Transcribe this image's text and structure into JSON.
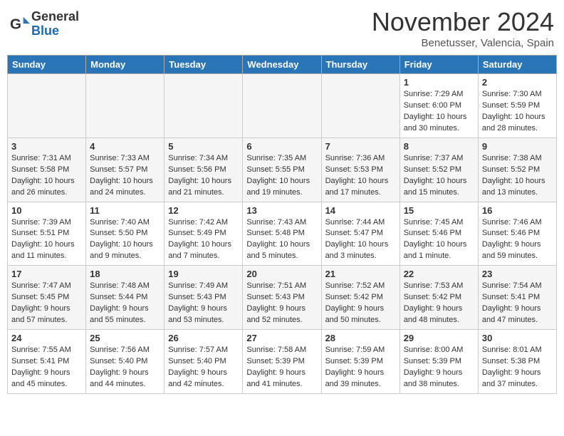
{
  "header": {
    "logo_general": "General",
    "logo_blue": "Blue",
    "month": "November 2024",
    "location": "Benetusser, Valencia, Spain"
  },
  "weekdays": [
    "Sunday",
    "Monday",
    "Tuesday",
    "Wednesday",
    "Thursday",
    "Friday",
    "Saturday"
  ],
  "weeks": [
    [
      {
        "day": "",
        "info": ""
      },
      {
        "day": "",
        "info": ""
      },
      {
        "day": "",
        "info": ""
      },
      {
        "day": "",
        "info": ""
      },
      {
        "day": "",
        "info": ""
      },
      {
        "day": "1",
        "info": "Sunrise: 7:29 AM\nSunset: 6:00 PM\nDaylight: 10 hours\nand 30 minutes."
      },
      {
        "day": "2",
        "info": "Sunrise: 7:30 AM\nSunset: 5:59 PM\nDaylight: 10 hours\nand 28 minutes."
      }
    ],
    [
      {
        "day": "3",
        "info": "Sunrise: 7:31 AM\nSunset: 5:58 PM\nDaylight: 10 hours\nand 26 minutes."
      },
      {
        "day": "4",
        "info": "Sunrise: 7:33 AM\nSunset: 5:57 PM\nDaylight: 10 hours\nand 24 minutes."
      },
      {
        "day": "5",
        "info": "Sunrise: 7:34 AM\nSunset: 5:56 PM\nDaylight: 10 hours\nand 21 minutes."
      },
      {
        "day": "6",
        "info": "Sunrise: 7:35 AM\nSunset: 5:55 PM\nDaylight: 10 hours\nand 19 minutes."
      },
      {
        "day": "7",
        "info": "Sunrise: 7:36 AM\nSunset: 5:53 PM\nDaylight: 10 hours\nand 17 minutes."
      },
      {
        "day": "8",
        "info": "Sunrise: 7:37 AM\nSunset: 5:52 PM\nDaylight: 10 hours\nand 15 minutes."
      },
      {
        "day": "9",
        "info": "Sunrise: 7:38 AM\nSunset: 5:52 PM\nDaylight: 10 hours\nand 13 minutes."
      }
    ],
    [
      {
        "day": "10",
        "info": "Sunrise: 7:39 AM\nSunset: 5:51 PM\nDaylight: 10 hours\nand 11 minutes."
      },
      {
        "day": "11",
        "info": "Sunrise: 7:40 AM\nSunset: 5:50 PM\nDaylight: 10 hours\nand 9 minutes."
      },
      {
        "day": "12",
        "info": "Sunrise: 7:42 AM\nSunset: 5:49 PM\nDaylight: 10 hours\nand 7 minutes."
      },
      {
        "day": "13",
        "info": "Sunrise: 7:43 AM\nSunset: 5:48 PM\nDaylight: 10 hours\nand 5 minutes."
      },
      {
        "day": "14",
        "info": "Sunrise: 7:44 AM\nSunset: 5:47 PM\nDaylight: 10 hours\nand 3 minutes."
      },
      {
        "day": "15",
        "info": "Sunrise: 7:45 AM\nSunset: 5:46 PM\nDaylight: 10 hours\nand 1 minute."
      },
      {
        "day": "16",
        "info": "Sunrise: 7:46 AM\nSunset: 5:46 PM\nDaylight: 9 hours\nand 59 minutes."
      }
    ],
    [
      {
        "day": "17",
        "info": "Sunrise: 7:47 AM\nSunset: 5:45 PM\nDaylight: 9 hours\nand 57 minutes."
      },
      {
        "day": "18",
        "info": "Sunrise: 7:48 AM\nSunset: 5:44 PM\nDaylight: 9 hours\nand 55 minutes."
      },
      {
        "day": "19",
        "info": "Sunrise: 7:49 AM\nSunset: 5:43 PM\nDaylight: 9 hours\nand 53 minutes."
      },
      {
        "day": "20",
        "info": "Sunrise: 7:51 AM\nSunset: 5:43 PM\nDaylight: 9 hours\nand 52 minutes."
      },
      {
        "day": "21",
        "info": "Sunrise: 7:52 AM\nSunset: 5:42 PM\nDaylight: 9 hours\nand 50 minutes."
      },
      {
        "day": "22",
        "info": "Sunrise: 7:53 AM\nSunset: 5:42 PM\nDaylight: 9 hours\nand 48 minutes."
      },
      {
        "day": "23",
        "info": "Sunrise: 7:54 AM\nSunset: 5:41 PM\nDaylight: 9 hours\nand 47 minutes."
      }
    ],
    [
      {
        "day": "24",
        "info": "Sunrise: 7:55 AM\nSunset: 5:41 PM\nDaylight: 9 hours\nand 45 minutes."
      },
      {
        "day": "25",
        "info": "Sunrise: 7:56 AM\nSunset: 5:40 PM\nDaylight: 9 hours\nand 44 minutes."
      },
      {
        "day": "26",
        "info": "Sunrise: 7:57 AM\nSunset: 5:40 PM\nDaylight: 9 hours\nand 42 minutes."
      },
      {
        "day": "27",
        "info": "Sunrise: 7:58 AM\nSunset: 5:39 PM\nDaylight: 9 hours\nand 41 minutes."
      },
      {
        "day": "28",
        "info": "Sunrise: 7:59 AM\nSunset: 5:39 PM\nDaylight: 9 hours\nand 39 minutes."
      },
      {
        "day": "29",
        "info": "Sunrise: 8:00 AM\nSunset: 5:39 PM\nDaylight: 9 hours\nand 38 minutes."
      },
      {
        "day": "30",
        "info": "Sunrise: 8:01 AM\nSunset: 5:38 PM\nDaylight: 9 hours\nand 37 minutes."
      }
    ]
  ]
}
